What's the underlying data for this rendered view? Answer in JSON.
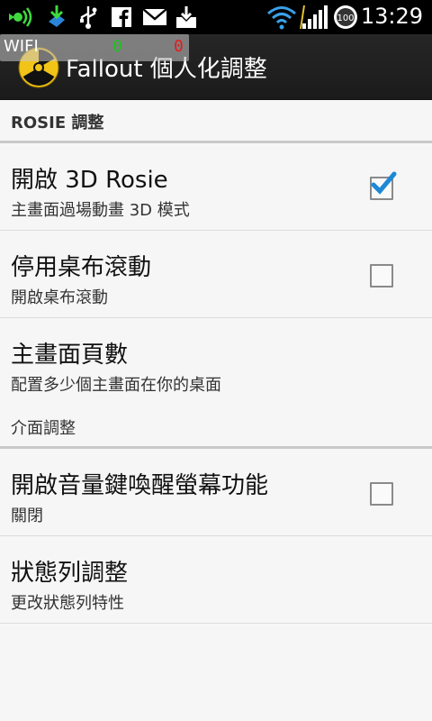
{
  "status_bar": {
    "time": "13:29",
    "battery_level": "100",
    "icons": [
      "signal-sound-icon",
      "app-download-icon",
      "usb-icon",
      "facebook-icon",
      "mail-icon",
      "download-icon",
      "wifi-icon",
      "signal-bars-icon",
      "battery-icon"
    ]
  },
  "overlay": {
    "wifi_label": "WIFI",
    "up_value": "0",
    "down_value": "0",
    "up_color": "#22c122",
    "down_color": "#e11d1d"
  },
  "action_bar": {
    "title": "Fallout 個人化調整",
    "logo_icon": "radiation-logo-icon"
  },
  "sections": [
    {
      "header": "ROSIE 調整",
      "items": [
        {
          "title": "開啟 3D Rosie",
          "summary": "主畫面過場動畫 3D 模式",
          "checkbox": true,
          "checked": true
        },
        {
          "title": "停用桌布滾動",
          "summary": "開啟桌布滾動",
          "checkbox": true,
          "checked": false
        },
        {
          "title": "主畫面頁數",
          "summary": "配置多少個主畫面在你的桌面",
          "checkbox": false,
          "checked": false
        }
      ]
    },
    {
      "header": "介面調整",
      "items": [
        {
          "title": "開啟音量鍵喚醒螢幕功能",
          "summary": "關閉",
          "checkbox": true,
          "checked": false
        },
        {
          "title": "狀態列調整",
          "summary": "更改狀態列特性",
          "checkbox": false,
          "checked": false
        }
      ]
    }
  ],
  "colors": {
    "check_accent": "#1e88d6",
    "background": "#f6f6f6",
    "action_bar": "#1f1f1f"
  }
}
